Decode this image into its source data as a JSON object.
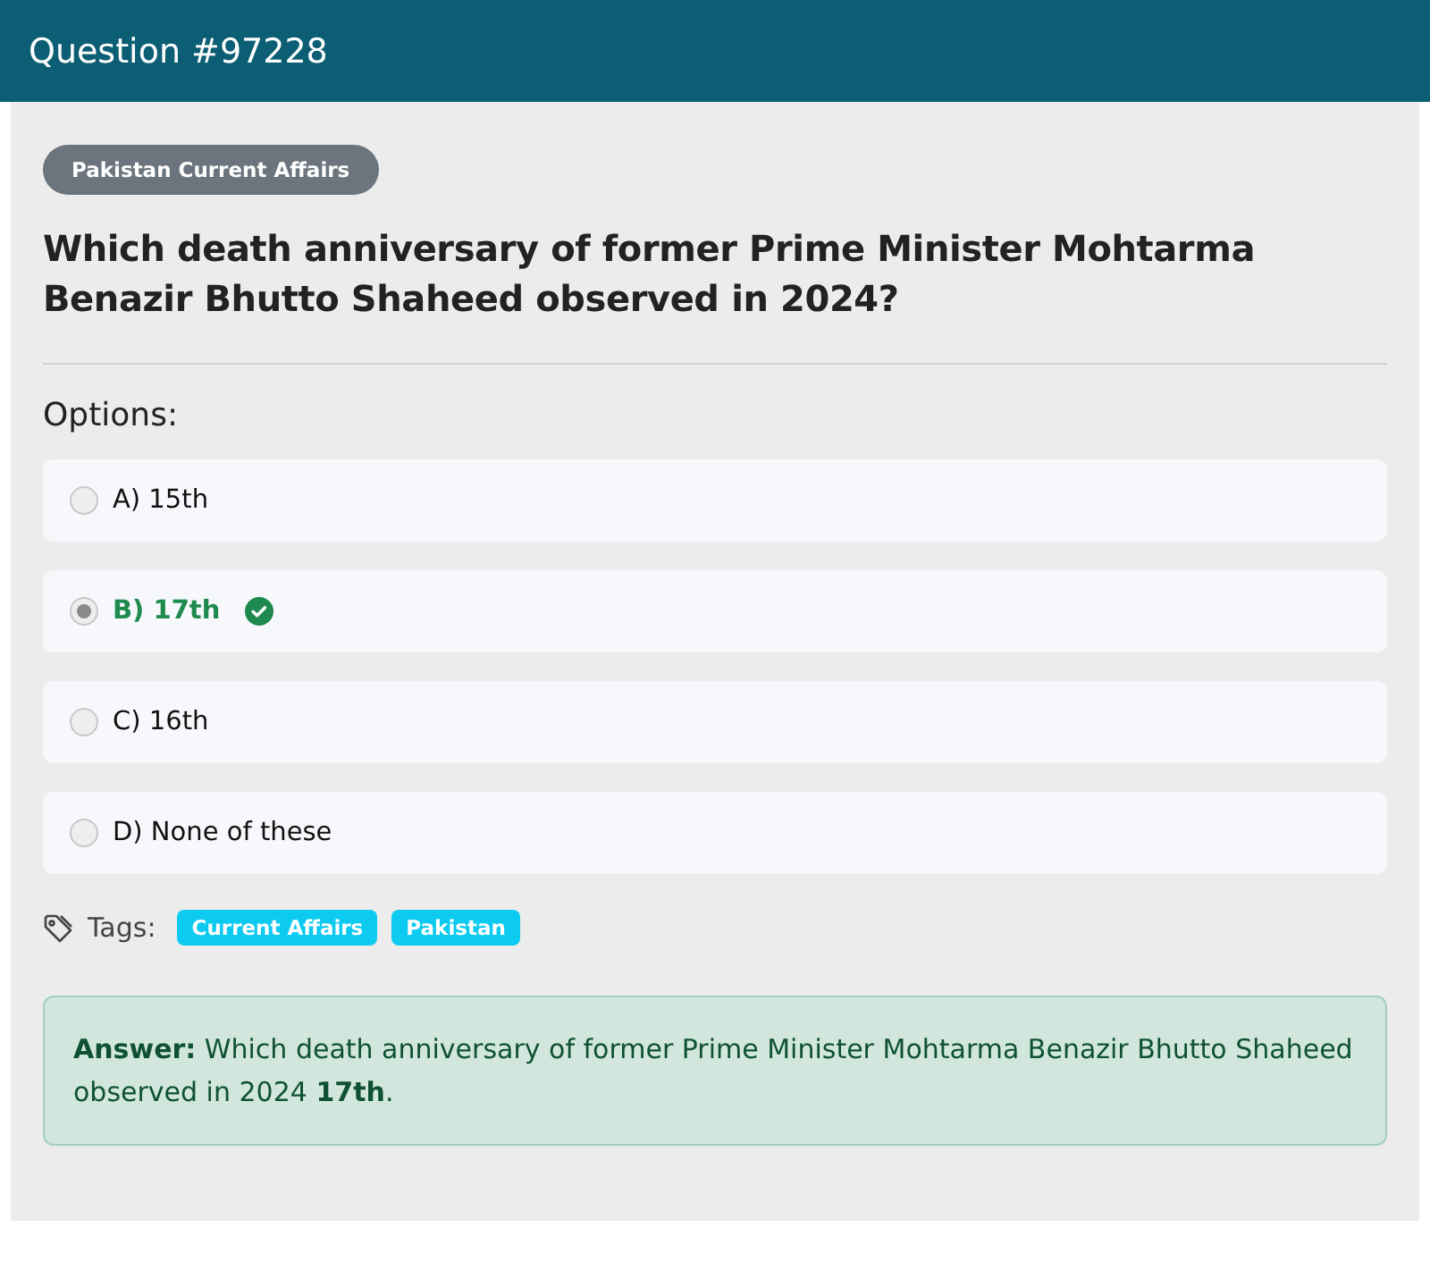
{
  "header": {
    "title": "Question #97228"
  },
  "category": "Pakistan Current Affairs",
  "question": "Which death anniversary of former Prime Minister Mohtarma Benazir Bhutto Shaheed observed in 2024?",
  "options_label": "Options:",
  "options": [
    {
      "label": "A) 15th",
      "selected": false,
      "correct": false
    },
    {
      "label": "B) 17th",
      "selected": true,
      "correct": true
    },
    {
      "label": "C) 16th",
      "selected": false,
      "correct": false
    },
    {
      "label": "D) None of these",
      "selected": false,
      "correct": false
    }
  ],
  "tags_label": "Tags:",
  "tags": [
    "Current Affairs",
    "Pakistan"
  ],
  "answer": "**Answer:** Which death anniversary of former Prime Minister Mohtarma Benazir Bhutto Shaheed observed in 2024 **17th**."
}
